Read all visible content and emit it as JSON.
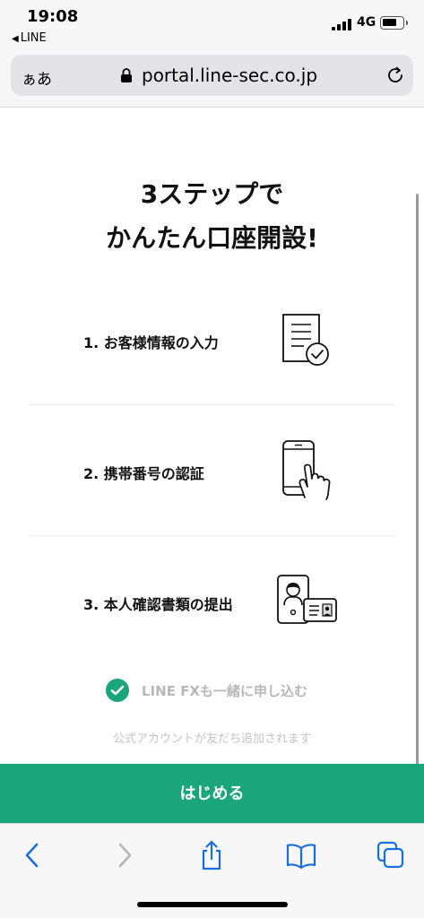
{
  "status_bar": {
    "time": "19:08",
    "back_app": "LINE",
    "network": "4G",
    "battery_level": 0.75
  },
  "browser": {
    "text_size_label": "ぁあ",
    "url": "portal.line-sec.co.jp"
  },
  "page": {
    "heading_line1": "3ステップで",
    "heading_line2": "かんたん口座開設!",
    "steps": [
      {
        "label": "1. お客様情報の入力",
        "icon": "form-check-icon"
      },
      {
        "label": "2. 携帯番号の認証",
        "icon": "phone-tap-icon"
      },
      {
        "label": "3. 本人確認書類の提出",
        "icon": "id-card-icon"
      }
    ],
    "fx_option": {
      "label": "LINE FXも一緒に申し込む",
      "checked": true
    },
    "note": "公式アカウントが友だち追加されます",
    "start_button": "はじめる"
  },
  "colors": {
    "accent": "#1aa57a",
    "ios_blue": "#1a6fe0"
  },
  "toolbar_icons": [
    "back-arrow-icon",
    "forward-arrow-icon",
    "share-icon",
    "bookmarks-icon",
    "tabs-icon"
  ]
}
